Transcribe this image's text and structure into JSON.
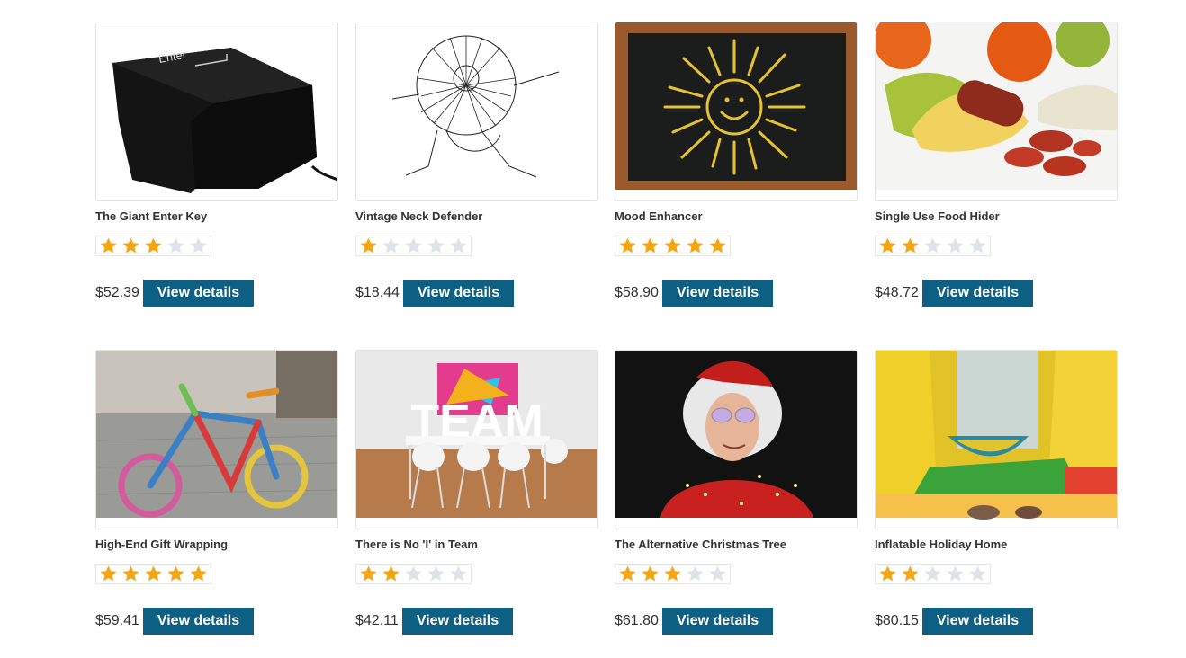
{
  "colors": {
    "button_bg": "#0e5f84",
    "star_filled": "#f5a511",
    "star_empty": "#dde3e6"
  },
  "products": [
    {
      "name": "The Giant Enter Key",
      "rating": 3,
      "max_rating": 5,
      "price": "$52.39",
      "button": "View details",
      "image": "giant-enter-key-image"
    },
    {
      "name": "Vintage Neck Defender",
      "rating": 1,
      "max_rating": 5,
      "price": "$18.44",
      "button": "View details",
      "image": "vintage-neck-defender-image"
    },
    {
      "name": "Mood Enhancer",
      "rating": 5,
      "max_rating": 5,
      "price": "$58.90",
      "button": "View details",
      "image": "mood-enhancer-image"
    },
    {
      "name": "Single Use Food Hider",
      "rating": 2,
      "max_rating": 5,
      "price": "$48.72",
      "button": "View details",
      "image": "food-hider-image"
    },
    {
      "name": "High-End Gift Wrapping",
      "rating": 5,
      "max_rating": 5,
      "price": "$59.41",
      "button": "View details",
      "image": "gift-wrapping-image"
    },
    {
      "name": "There is No 'I' in Team",
      "rating": 2,
      "max_rating": 5,
      "price": "$42.11",
      "button": "View details",
      "image": "team-image",
      "image_text": "TEAM"
    },
    {
      "name": "The Alternative Christmas Tree",
      "rating": 3,
      "max_rating": 5,
      "price": "$61.80",
      "button": "View details",
      "image": "christmas-tree-image"
    },
    {
      "name": "Inflatable Holiday Home",
      "rating": 2,
      "max_rating": 5,
      "price": "$80.15",
      "button": "View details",
      "image": "inflatable-home-image"
    }
  ],
  "enter_key_text": "Enter"
}
